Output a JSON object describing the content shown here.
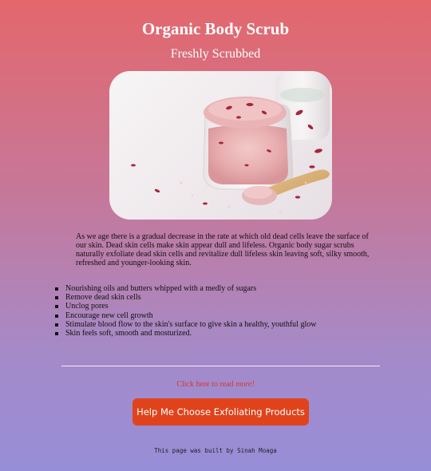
{
  "header": {
    "title": "Organic Body Scrub",
    "subtitle": "Freshly Scrubbed"
  },
  "main": {
    "description": "As we age there is a gradual decrease in the rate at which old dead cells leave the surface of our skin. Dead skin cells make skin appear dull and lifeless. Organic body sugar scrubs naturally exfoliate dead skin cells and revitalize dull lifeless skin leaving soft, silky smooth, refreshed and younger-looking skin.",
    "benefits": [
      "Nourishing oils and butters whipped with a medly of sugars",
      "Remove dead skin cells",
      "Unclog pores",
      "Encourage new cell growth",
      "Stimulate blood flow to the skin's surface to give skin a healthy, youthful glow",
      "Skin feels soft, smooth and mosturized."
    ],
    "read_more_prefix": "Click here to read ",
    "read_more_link": "more!",
    "cta_label": "Help Me Choose Exfoliating Products"
  },
  "footer": {
    "credit": "This page was built by Sinah Moaga"
  },
  "colors": {
    "gradient_top": "#e4676c",
    "gradient_bottom": "#978ed8",
    "button": "#e0431b",
    "link": "#d9372b"
  }
}
